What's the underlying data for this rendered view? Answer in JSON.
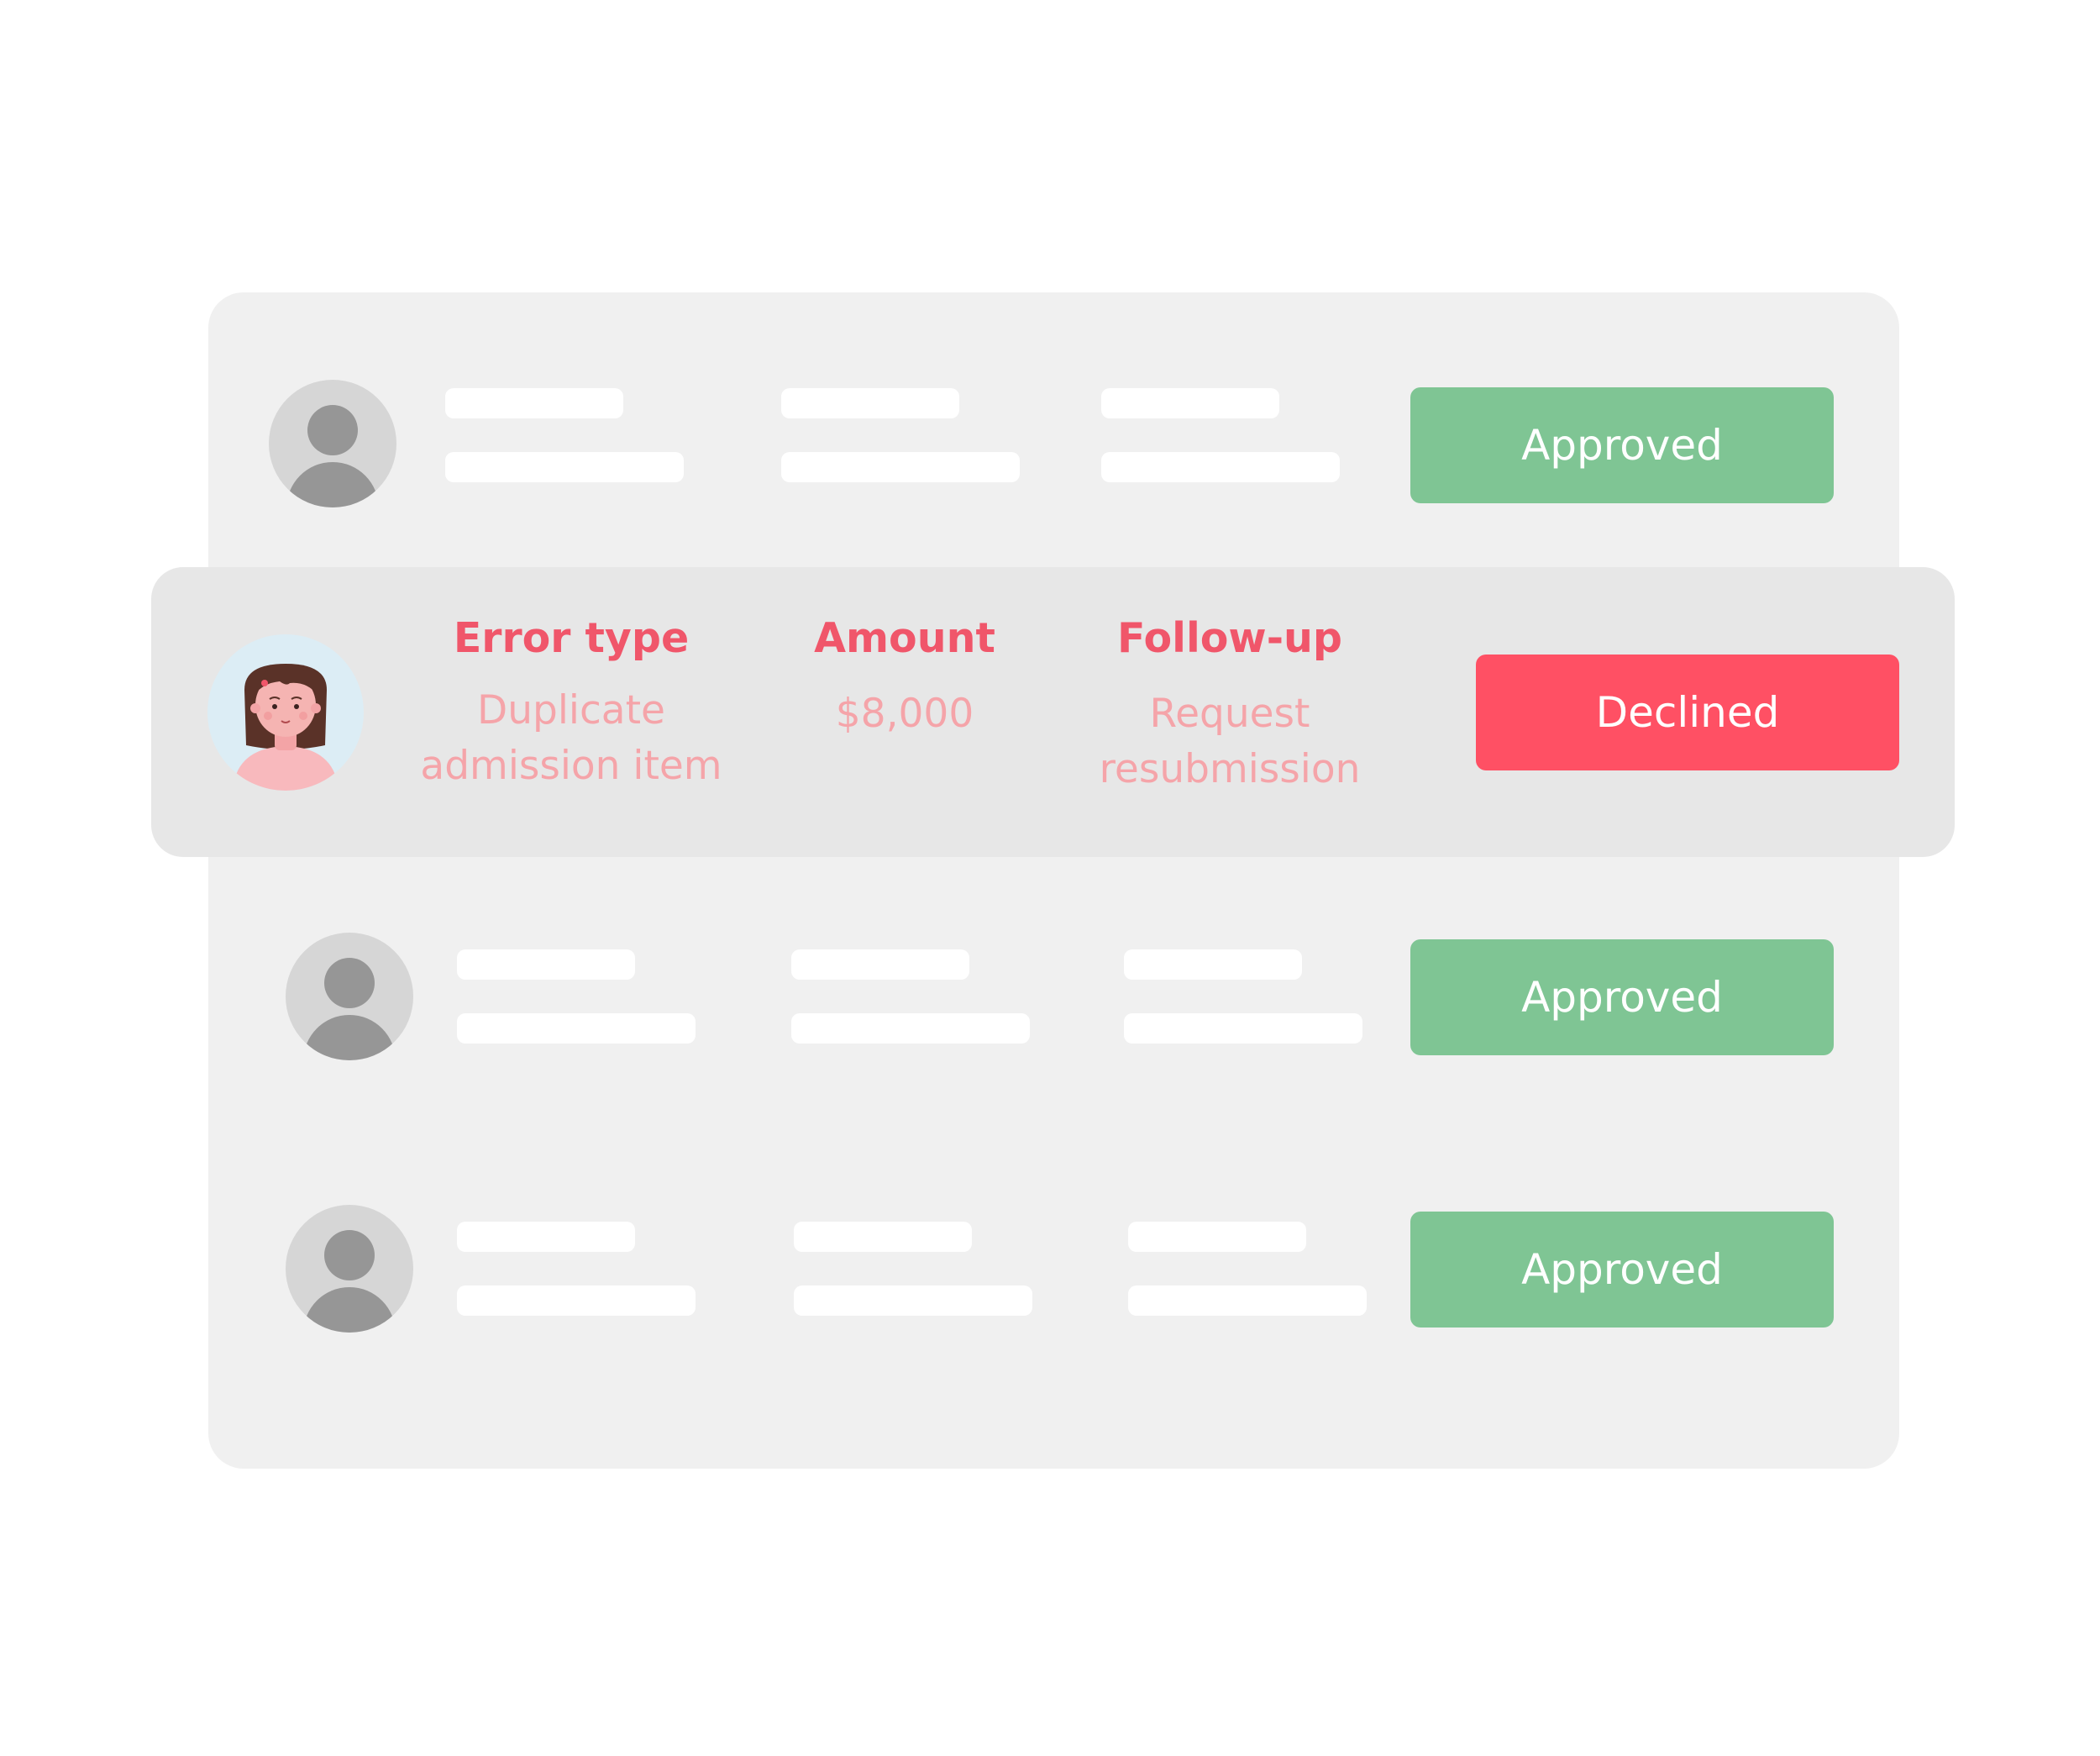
{
  "colors": {
    "panel": "#f0f0f0",
    "highlight": "#e7e7e7",
    "approved": "#7fc594",
    "declined": "#ff5064",
    "header_text": "#f0566a",
    "value_text": "#f5a4a9"
  },
  "rows": [
    {
      "status": "Approved"
    },
    {
      "headers": {
        "error_type": "Error type",
        "amount": "Amount",
        "follow_up": "Follow-up"
      },
      "values": {
        "error_type_line1": "Duplicate",
        "error_type_line2": "admission item",
        "amount": "$8,000",
        "follow_up_line1": "Request",
        "follow_up_line2": "resubmission"
      },
      "status": "Declined",
      "avatar_icon": "user-avatar-icon"
    },
    {
      "status": "Approved"
    },
    {
      "status": "Approved"
    }
  ]
}
